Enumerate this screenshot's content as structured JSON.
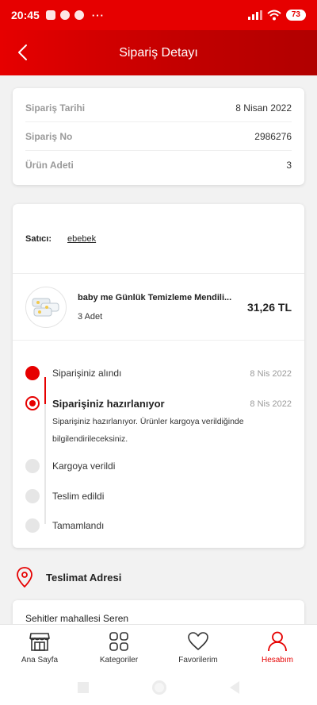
{
  "status_bar": {
    "time": "20:45",
    "dots": "···",
    "battery": "73"
  },
  "header": {
    "title": "Sipariş Detayı"
  },
  "order_info": {
    "rows": [
      {
        "label": "Sipariş Tarihi",
        "value": "8 Nisan 2022"
      },
      {
        "label": "Sipariş No",
        "value": "2986276"
      },
      {
        "label": "Ürün Adeti",
        "value": "3"
      }
    ]
  },
  "seller": {
    "label": "Satıcı:",
    "name": "ebebek"
  },
  "product": {
    "name": "baby me Günlük Temizleme Mendili...",
    "qty": "3 Adet",
    "price": "31,26 TL"
  },
  "timeline": [
    {
      "title": "Siparişiniz alındı",
      "date": "8 Nis 2022",
      "status": "done"
    },
    {
      "title": "Siparişiniz hazırlanıyor",
      "date": "8 Nis 2022",
      "status": "active",
      "desc": "Siparişiniz hazırlanıyor. Ürünler kargoya verildiğinde bilgilendirileceksiniz."
    },
    {
      "title": "Kargoya verildi",
      "status": "pending"
    },
    {
      "title": "Teslim edildi",
      "status": "pending"
    },
    {
      "title": "Tamamlandı",
      "status": "pending"
    }
  ],
  "address": {
    "title": "Teslimat Adresi",
    "text": "Sehitler mahallesi Seren"
  },
  "bottom_nav": [
    {
      "label": "Ana Sayfa",
      "icon": "store-icon"
    },
    {
      "label": "Kategoriler",
      "icon": "grid-icon"
    },
    {
      "label": "Favorilerim",
      "icon": "heart-icon"
    },
    {
      "label": "Hesabım",
      "icon": "user-icon",
      "active": true
    }
  ],
  "colors": {
    "brand": "#e60000",
    "muted": "#9a9a9a",
    "pending": "#e6e6e6"
  }
}
